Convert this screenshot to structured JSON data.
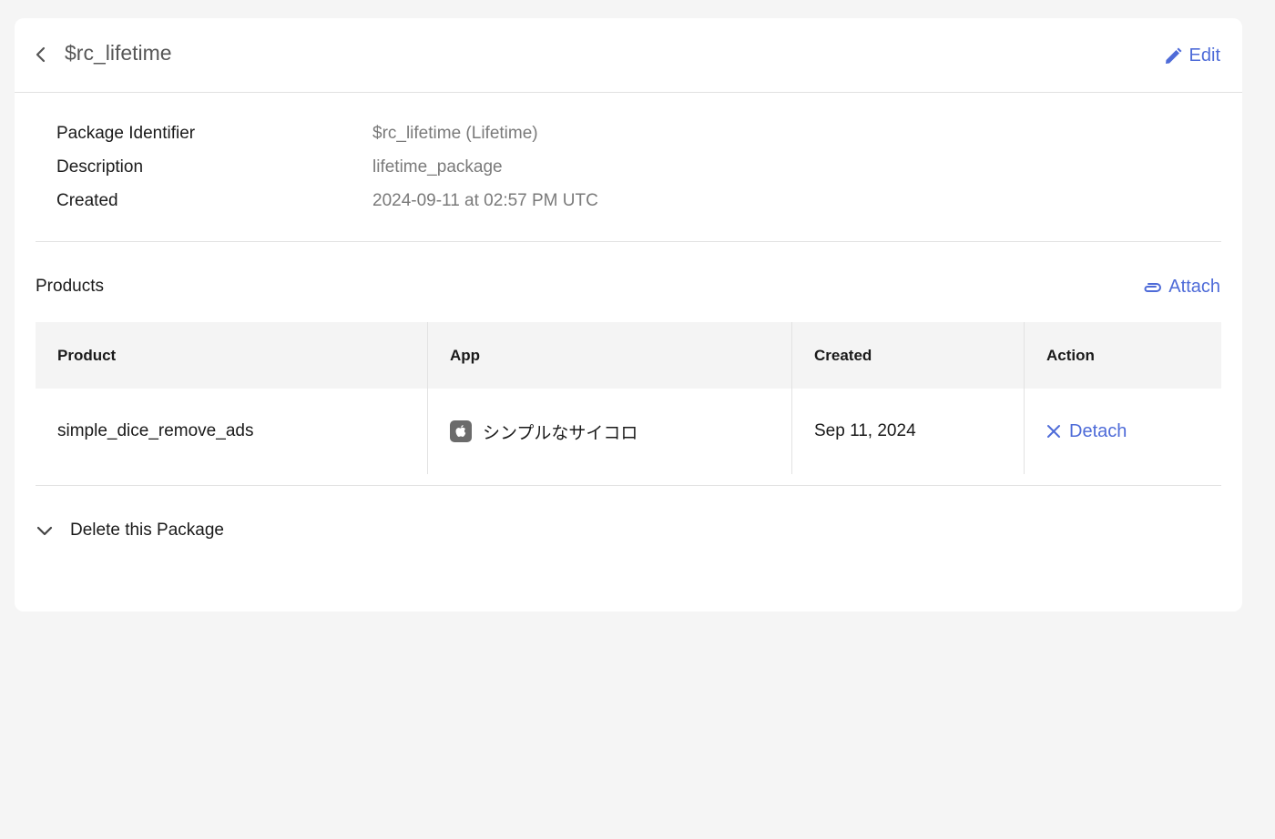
{
  "header": {
    "title": "$rc_lifetime",
    "edit_label": "Edit"
  },
  "details": [
    {
      "label": "Package Identifier",
      "value": "$rc_lifetime (Lifetime)"
    },
    {
      "label": "Description",
      "value": "lifetime_package"
    },
    {
      "label": "Created",
      "value": "2024-09-11 at 02:57 PM UTC"
    }
  ],
  "products": {
    "title": "Products",
    "attach_label": "Attach",
    "columns": [
      "Product",
      "App",
      "Created",
      "Action"
    ],
    "rows": [
      {
        "product": "simple_dice_remove_ads",
        "app_icon": "apple-icon",
        "app": "シンプルなサイコロ",
        "created": "Sep 11, 2024",
        "action": "Detach"
      }
    ]
  },
  "delete_section": {
    "label": "Delete this Package"
  },
  "colors": {
    "accent": "#4e6bd8",
    "background": "#f5f5f5",
    "card": "#ffffff",
    "table_header": "#f4f4f4"
  }
}
